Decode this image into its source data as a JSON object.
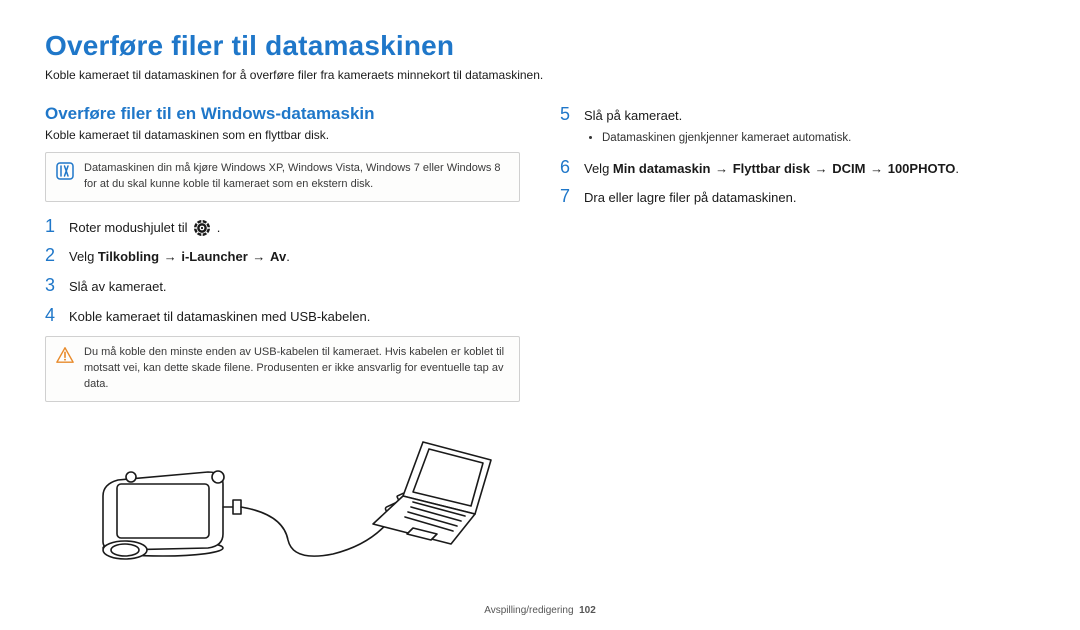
{
  "title": "Overføre filer til datamaskinen",
  "intro": "Koble kameraet til datamaskinen for å overføre filer fra kameraets minnekort til datamaskinen.",
  "left": {
    "subheading": "Overføre filer til en Windows-datamaskin",
    "subintro": "Koble kameraet til datamaskinen som en flyttbar disk.",
    "notebox": "Datamaskinen din må kjøre Windows XP, Windows Vista, Windows 7 eller Windows 8 for at du skal kunne koble til kameraet som en ekstern disk.",
    "step1_prefix": "Roter modushjulet til ",
    "step1_suffix": ".",
    "step2_prefix": "Velg ",
    "step2_b1": "Tilkobling",
    "step2_b2": "i-Launcher",
    "step2_b3": "Av",
    "step3": "Slå av kameraet.",
    "step4": "Koble kameraet til datamaskinen med USB-kabelen.",
    "warnbox": "Du må koble den minste enden av USB-kabelen til kameraet. Hvis kabelen er koblet til motsatt vei, kan dette skade filene. Produsenten er ikke ansvarlig for eventuelle tap av data."
  },
  "right": {
    "step5": "Slå på kameraet.",
    "step5_bullet": "Datamaskinen gjenkjenner kameraet automatisk.",
    "step6_prefix": "Velg ",
    "step6_b1": "Min datamaskin",
    "step6_b2": "Flyttbar disk",
    "step6_b3": "DCIM",
    "step6_b4": "100PHOTO",
    "step7": "Dra eller lagre filer på datamaskinen."
  },
  "nums": {
    "n1": "1",
    "n2": "2",
    "n3": "3",
    "n4": "4",
    "n5": "5",
    "n6": "6",
    "n7": "7",
    "dot": "."
  },
  "arrow_glyph": "→",
  "footer": {
    "section": "Avspilling/redigering",
    "page": "102"
  },
  "icons": {
    "note": "note-icon",
    "warn": "warning-icon",
    "dial": "mode-dial-icon"
  },
  "colors": {
    "accent": "#1f77c9",
    "warn": "#e88a2a"
  }
}
